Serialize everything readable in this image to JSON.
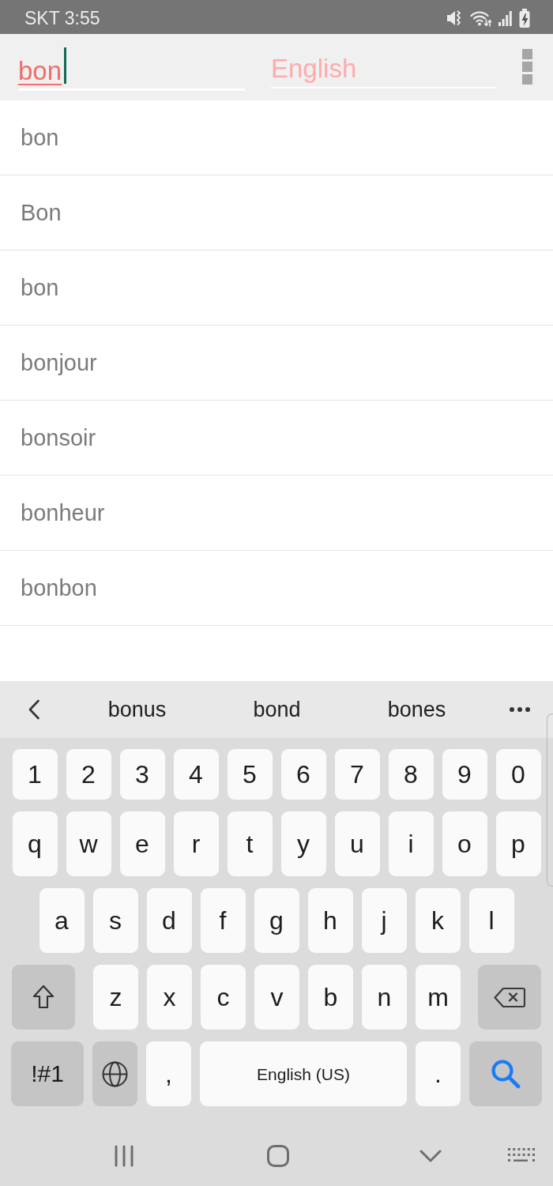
{
  "status_bar": {
    "text": "SKT 3:55"
  },
  "search_bar": {
    "query": "bon",
    "language_field": {
      "placeholder": "English"
    }
  },
  "results": [
    "bon",
    "Bon",
    "bon",
    "bonjour",
    "bonsoir",
    "bonheur",
    "bonbon"
  ],
  "keyboard": {
    "suggestions": [
      "bonus",
      "bond",
      "bones"
    ],
    "rows": [
      {
        "kind": "numbers",
        "keys": [
          {
            "kind": "char",
            "label": "1"
          },
          {
            "kind": "char",
            "label": "2"
          },
          {
            "kind": "char",
            "label": "3"
          },
          {
            "kind": "char",
            "label": "4"
          },
          {
            "kind": "char",
            "label": "5"
          },
          {
            "kind": "char",
            "label": "6"
          },
          {
            "kind": "char",
            "label": "7"
          },
          {
            "kind": "char",
            "label": "8"
          },
          {
            "kind": "char",
            "label": "9"
          },
          {
            "kind": "char",
            "label": "0"
          }
        ]
      },
      {
        "kind": "letters",
        "keys": [
          {
            "kind": "char",
            "label": "q"
          },
          {
            "kind": "char",
            "label": "w"
          },
          {
            "kind": "char",
            "label": "e"
          },
          {
            "kind": "char",
            "label": "r"
          },
          {
            "kind": "char",
            "label": "t"
          },
          {
            "kind": "char",
            "label": "y"
          },
          {
            "kind": "char",
            "label": "u"
          },
          {
            "kind": "char",
            "label": "i"
          },
          {
            "kind": "char",
            "label": "o"
          },
          {
            "kind": "char",
            "label": "p"
          }
        ]
      },
      {
        "kind": "letters",
        "keys": [
          {
            "kind": "char",
            "label": "a"
          },
          {
            "kind": "char",
            "label": "s"
          },
          {
            "kind": "char",
            "label": "d"
          },
          {
            "kind": "char",
            "label": "f"
          },
          {
            "kind": "char",
            "label": "g"
          },
          {
            "kind": "char",
            "label": "h"
          },
          {
            "kind": "char",
            "label": "j"
          },
          {
            "kind": "char",
            "label": "k"
          },
          {
            "kind": "char",
            "label": "l"
          }
        ]
      },
      {
        "kind": "letters",
        "keys": [
          {
            "kind": "shift"
          },
          {
            "kind": "char",
            "label": "z"
          },
          {
            "kind": "char",
            "label": "x"
          },
          {
            "kind": "char",
            "label": "c"
          },
          {
            "kind": "char",
            "label": "v"
          },
          {
            "kind": "char",
            "label": "b"
          },
          {
            "kind": "char",
            "label": "n"
          },
          {
            "kind": "char",
            "label": "m"
          },
          {
            "kind": "backspace"
          }
        ]
      },
      {
        "kind": "letters",
        "keys": [
          {
            "kind": "symbols",
            "label": "!#1"
          },
          {
            "kind": "globe"
          },
          {
            "kind": "char",
            "label": ","
          },
          {
            "kind": "space",
            "label": "English (US)"
          },
          {
            "kind": "char",
            "label": "."
          },
          {
            "kind": "search"
          }
        ]
      }
    ]
  }
}
